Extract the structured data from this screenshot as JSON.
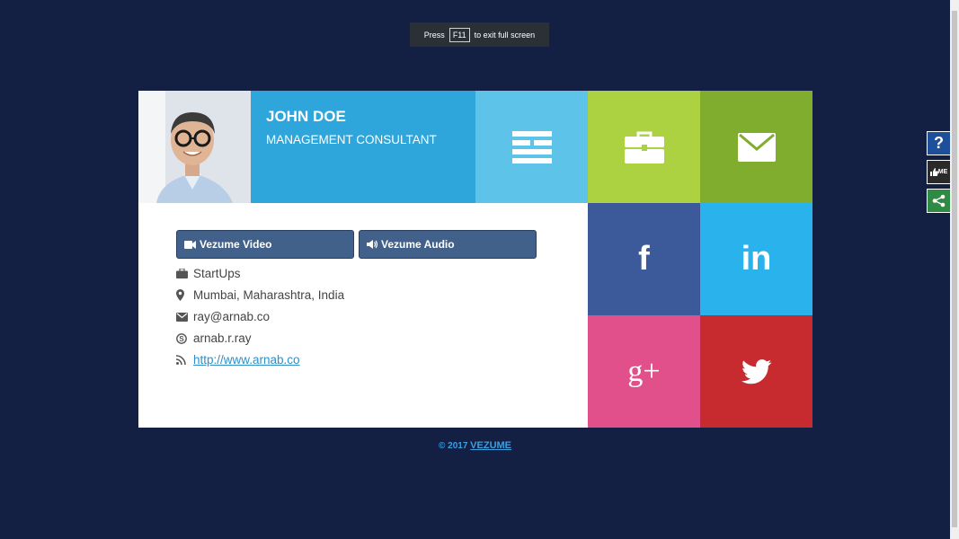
{
  "fullscreen_banner": {
    "press": "Press",
    "key": "F11",
    "suffix": "to exit full screen"
  },
  "profile": {
    "name": "JOHN DOE",
    "title": "MANAGEMENT CONSULTANT"
  },
  "buttons": {
    "video": "Vezume Video",
    "audio": "Vezume Audio"
  },
  "details": {
    "industry": "StartUps",
    "location": "Mumbai, Maharashtra, India",
    "email": "ray@arnab.co",
    "skype": "arnab.r.ray",
    "website": "http://www.arnab.co"
  },
  "tiles": {
    "facebook": "f",
    "linkedin": "in",
    "googleplus": "g+"
  },
  "footer": {
    "copyright": "© 2017",
    "brand": "VEZUME"
  },
  "sidebar": {
    "help": "?",
    "like": "ME"
  },
  "colors": {
    "background": "#141f44",
    "name_block": "#2ea6db",
    "menu_tile": "#5ec3e9",
    "briefcase_tile": "#acd141",
    "mail_tile": "#80ad2d",
    "facebook_tile": "#3c5a99",
    "linkedin_tile": "#2ab2ed",
    "googleplus_tile": "#e1508a",
    "twitter_tile": "#c72a2f"
  }
}
